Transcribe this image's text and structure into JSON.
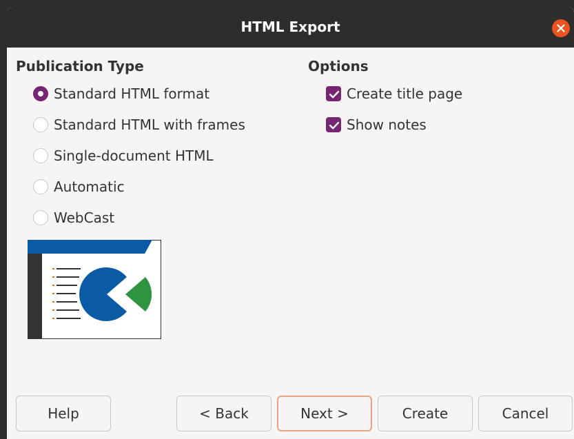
{
  "window": {
    "title": "HTML Export"
  },
  "publication_type": {
    "heading": "Publication Type",
    "options": [
      {
        "label": "Standard HTML format",
        "selected": true
      },
      {
        "label": "Standard HTML with frames",
        "selected": false
      },
      {
        "label": "Single-document HTML",
        "selected": false
      },
      {
        "label": "Automatic",
        "selected": false
      },
      {
        "label": "WebCast",
        "selected": false
      }
    ]
  },
  "options": {
    "heading": "Options",
    "items": [
      {
        "label": "Create title page",
        "checked": true
      },
      {
        "label": "Show notes",
        "checked": true
      }
    ]
  },
  "buttons": {
    "help": "Help",
    "back": "< Back",
    "next": "Next >",
    "create": "Create",
    "cancel": "Cancel"
  },
  "colors": {
    "accent": "#762572",
    "titlebar": "#2d2d2d",
    "close": "#e95420",
    "preview_blue": "#0a5aa5",
    "preview_green": "#2e9440",
    "preview_orange": "#e8731e"
  }
}
